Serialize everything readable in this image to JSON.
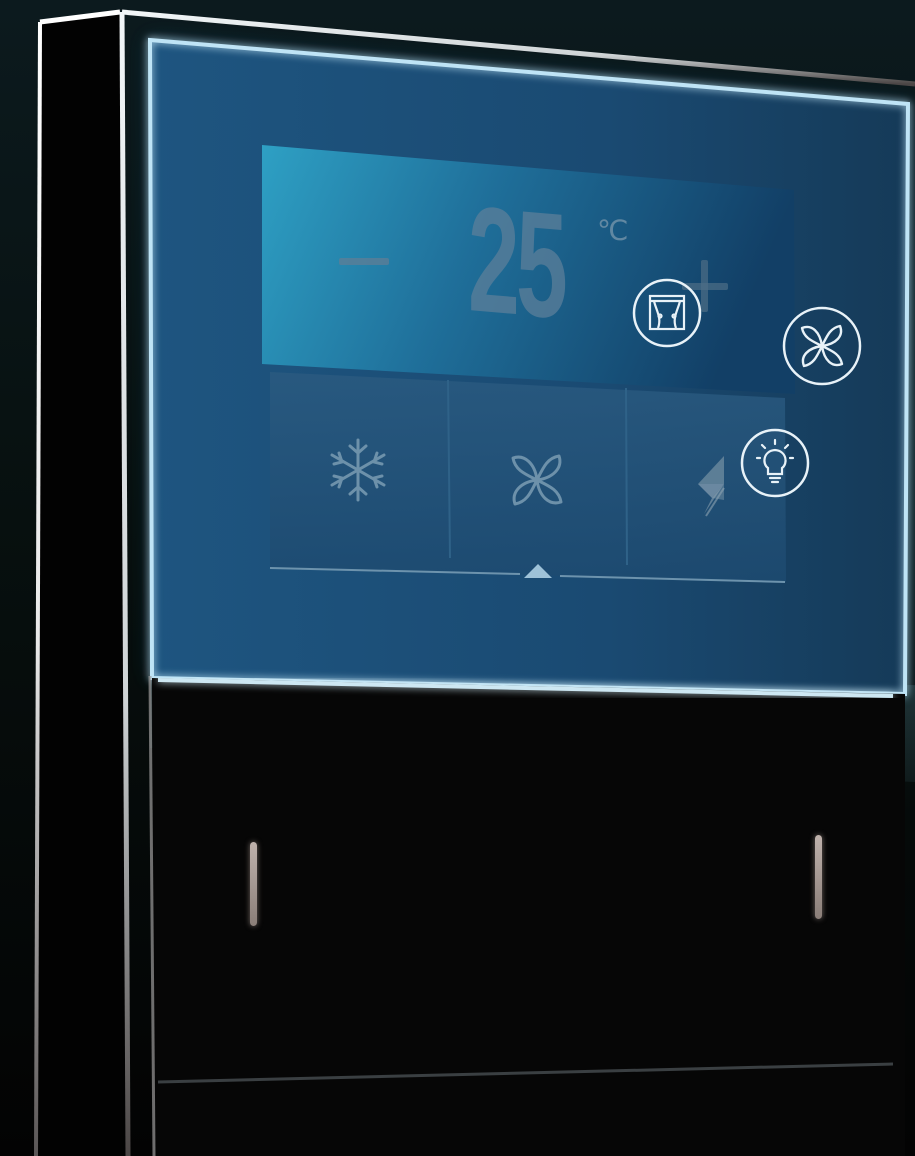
{
  "display": {
    "temperature": "25",
    "unit": "℃"
  },
  "controls": {
    "decrease_icon": "minus-icon",
    "increase_icon": "plus-icon"
  },
  "modes": [
    {
      "icon": "snowflake-icon"
    },
    {
      "icon": "fan-icon"
    },
    {
      "icon": "fan-speed-icon"
    }
  ],
  "floating_icons": [
    {
      "icon": "curtain-icon"
    },
    {
      "icon": "fan-icon"
    },
    {
      "icon": "lightbulb-icon"
    }
  ],
  "indicators": [
    {
      "icon": "led-indicator-left"
    },
    {
      "icon": "led-indicator-right"
    }
  ],
  "colors": {
    "panel_blue": "#1d4f78",
    "panel_edge": "#bfe4f6",
    "display_cyan": "#2e93b6",
    "frame_white": "#f4f4f4",
    "background": "#030303"
  }
}
